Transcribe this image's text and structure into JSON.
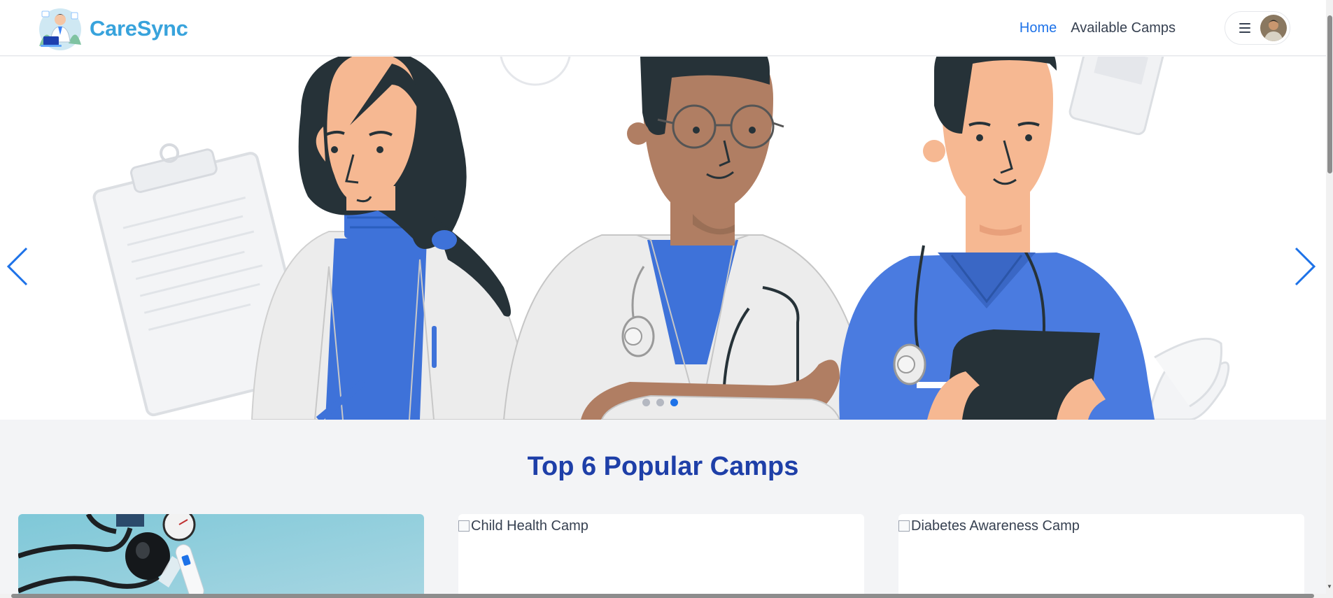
{
  "brand": {
    "name": "CareSync"
  },
  "nav": {
    "links": [
      {
        "label": "Home",
        "active": true
      },
      {
        "label": "Available Camps",
        "active": false
      }
    ]
  },
  "hero": {
    "slide_count": 3,
    "active_slide": 3
  },
  "popular": {
    "title": "Top 6 Popular Camps",
    "cards": [
      {
        "image_alt": "",
        "image_loaded": true
      },
      {
        "image_alt": "Child Health Camp",
        "image_loaded": false
      },
      {
        "image_alt": "Diabetes Awareness Camp",
        "image_loaded": false
      }
    ]
  },
  "colors": {
    "brand": "#38a3dc",
    "nav_active": "#1d72e8",
    "section_title": "#1e3fa8",
    "scrub_blue": "#4a7be0"
  }
}
